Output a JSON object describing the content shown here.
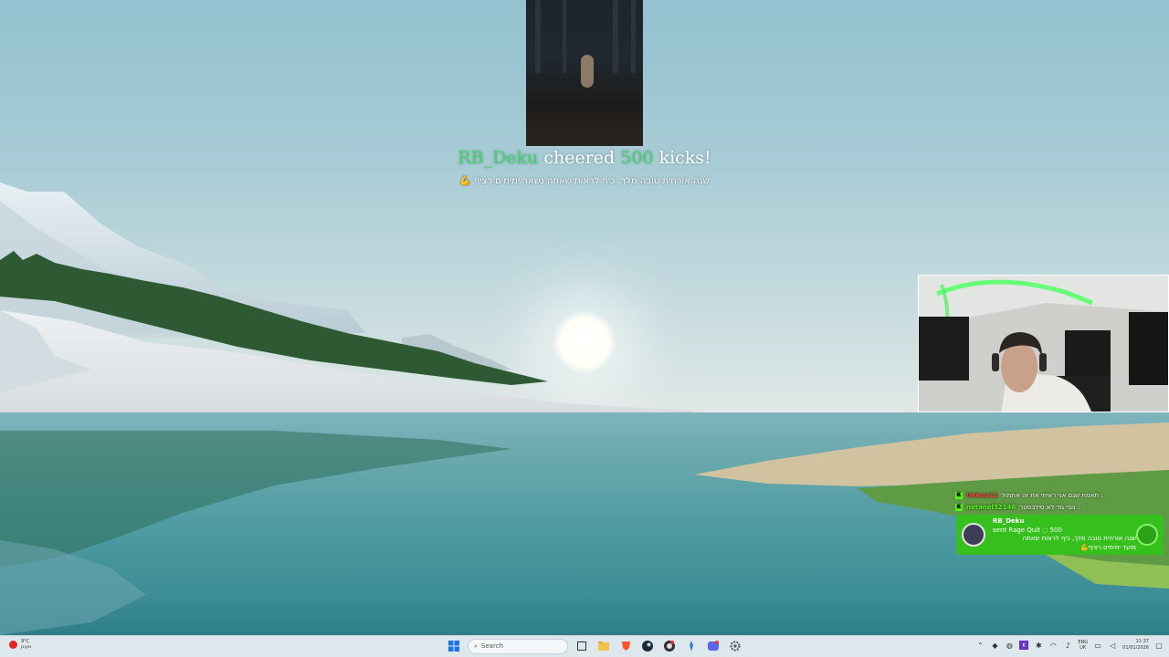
{
  "alert": {
    "username": "RB_Deku",
    "cheered_text": "cheered",
    "amount": "500",
    "kicks_text": "kicks!",
    "message": "שנה אורחית טובה מלך, כיף לראות שאתה נשאר ימימים רציף 💪"
  },
  "chat": {
    "messages": [
      {
        "badge": "K",
        "user": "Dekuu12",
        "text": ": תאמת שגם אני ראיתי את זה אתמול"
      },
      {
        "badge": "K",
        "user": "netanel32146",
        "text": ": נובי גוד לא סילבסטר"
      }
    ],
    "gift": {
      "user": "RB_Deku",
      "action": "sent Rage Quit",
      "amount": "500",
      "line1": "שנה אורחית טובה מלך, כיף לראות שאתה",
      "line2": "מועד ימימים רציף💪"
    }
  },
  "taskbar": {
    "weather": {
      "line1": "9°C",
      "line2": "מעונן"
    },
    "search_placeholder": "Search",
    "lang": {
      "line1": "ENG",
      "line2": "UK"
    },
    "clock": {
      "time": "11:37",
      "date": "01/01/2026"
    },
    "icons": [
      "windows-start-icon",
      "search-icon",
      "task-view-icon",
      "file-explorer-icon",
      "brave-browser-icon",
      "steam-icon",
      "obs-icon",
      "sparkle-icon",
      "discord-icon",
      "settings-icon"
    ]
  },
  "colors": {
    "kick_green": "#53fc18",
    "alert_highlight": "#3ed66b",
    "gift_card": "#36c01d"
  }
}
